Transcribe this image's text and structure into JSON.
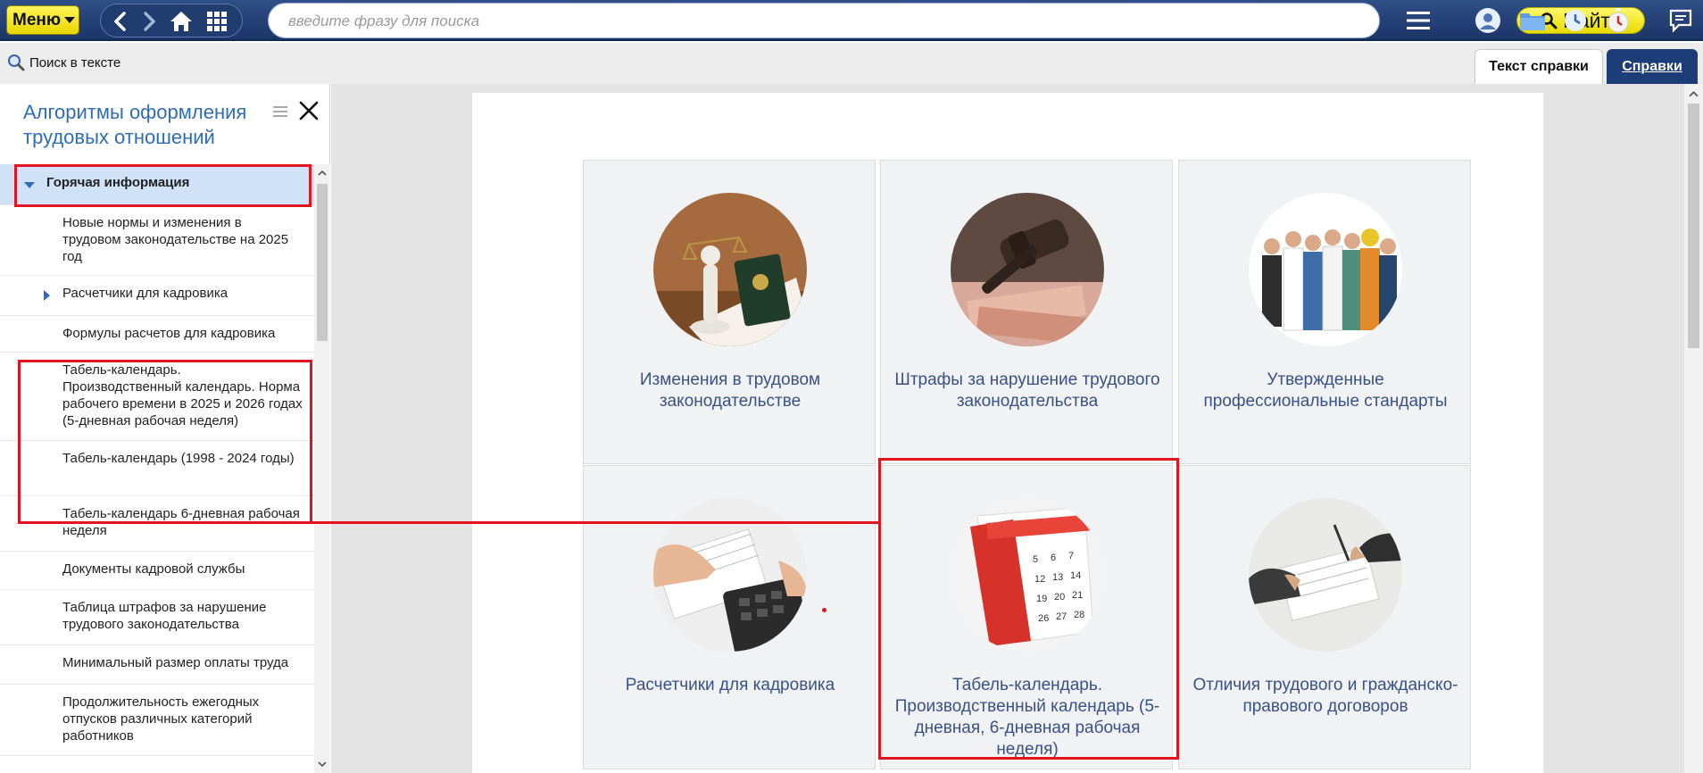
{
  "toolbar": {
    "menu_label": "Меню",
    "search_placeholder": "введите фразу для поиска",
    "find_label": "Найти"
  },
  "subbar": {
    "search_in_text_label": "Поиск в тексте",
    "tabs": [
      {
        "label": "Текст справки",
        "active": true
      },
      {
        "label": "Справки",
        "active": false
      }
    ]
  },
  "sidebar": {
    "title": "Алгоритмы оформления трудовых отношений",
    "items": [
      {
        "label": "Горячая информация",
        "expanded": true
      },
      {
        "label": "Новые нормы и изменения в трудовом законодательстве на 2025 год"
      },
      {
        "label": "Расчетчики для кадровика",
        "has_children": true
      },
      {
        "label": "Формулы расчетов для кадровика"
      },
      {
        "label": "Табель-календарь. Производственный календарь. Норма рабочего времени в 2025 и 2026 годах (5-дневная рабочая неделя)"
      },
      {
        "label": "Табель-календарь (1998 - 2024 годы)"
      },
      {
        "label": "Табель-календарь 6-дневная рабочая неделя"
      },
      {
        "label": "Документы кадровой службы"
      },
      {
        "label": "Таблица штрафов за нарушение трудового законодательства"
      },
      {
        "label": "Минимальный размер оплаты труда"
      },
      {
        "label": "Продолжительность ежегодных отпусков различных категорий работников"
      }
    ]
  },
  "tiles": [
    {
      "caption": "Изменения в трудовом законодательстве",
      "icon": "justice-statue-icon"
    },
    {
      "caption": "Штрафы за нарушение трудового законодательства",
      "icon": "gavel-money-icon"
    },
    {
      "caption": "Утвержденные профессиональные стандарты",
      "icon": "professionals-group-icon"
    },
    {
      "caption": "Расчетчики для кадровика",
      "icon": "calculator-hands-icon"
    },
    {
      "caption": "Табель-календарь. Производственный календарь (5-дневная, 6-дневная рабочая неделя)",
      "icon": "calendar-icon"
    },
    {
      "caption": "Отличия трудового и гражданско-правового договоров",
      "icon": "contract-signing-icon"
    }
  ],
  "colors": {
    "accent_red": "#e1141f",
    "header_blue": "#1d3d79",
    "menu_yellow": "#f5e600",
    "title_blue": "#2f6db6"
  }
}
